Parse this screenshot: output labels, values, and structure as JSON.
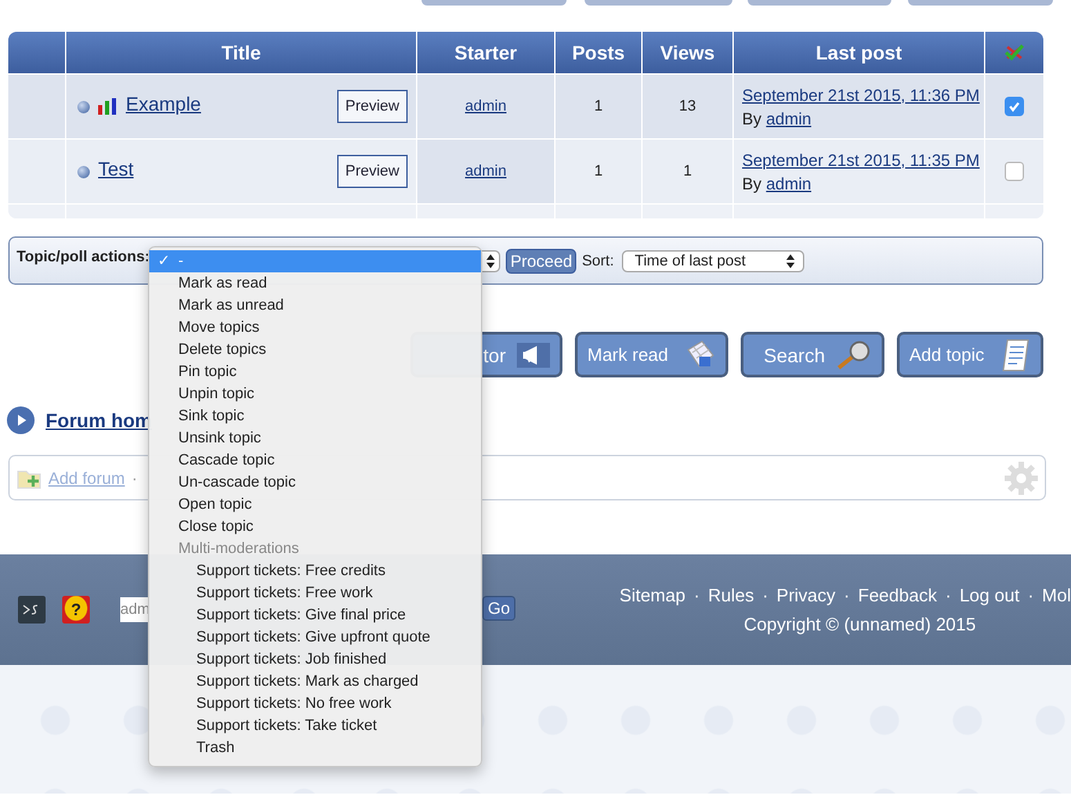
{
  "table": {
    "columns": [
      "Title",
      "Starter",
      "Posts",
      "Views",
      "Last post"
    ],
    "rows": [
      {
        "kind": "poll",
        "title": "Example",
        "preview": "Preview",
        "starter": "admin",
        "posts": "1",
        "views": "13",
        "last_post": "September 21st 2015, 11:36 PM",
        "by": "By",
        "last_author": "admin",
        "checked": true
      },
      {
        "kind": "topic",
        "title": "Test",
        "preview": "Preview",
        "starter": "admin",
        "posts": "1",
        "views": "1",
        "last_post": "September 21st 2015, 11:35 PM",
        "by": "By",
        "last_author": "admin",
        "checked": false
      }
    ]
  },
  "actions": {
    "label": "Topic/poll actions:",
    "proceed": "Proceed",
    "sort_label": "Sort:",
    "sort_value": "Time of last post"
  },
  "menu": {
    "check_mark": "✓",
    "items": [
      {
        "kind": "option",
        "label": "-",
        "selected": true
      },
      {
        "kind": "option",
        "label": "Mark as read",
        "selected": false
      },
      {
        "kind": "option",
        "label": "Mark as unread",
        "selected": false
      },
      {
        "kind": "option",
        "label": "Move topics",
        "selected": false
      },
      {
        "kind": "option",
        "label": "Delete topics",
        "selected": false
      },
      {
        "kind": "option",
        "label": "Pin topic",
        "selected": false
      },
      {
        "kind": "option",
        "label": "Unpin topic",
        "selected": false
      },
      {
        "kind": "option",
        "label": "Sink topic",
        "selected": false
      },
      {
        "kind": "option",
        "label": "Unsink topic",
        "selected": false
      },
      {
        "kind": "option",
        "label": "Cascade topic",
        "selected": false
      },
      {
        "kind": "option",
        "label": "Un-cascade topic",
        "selected": false
      },
      {
        "kind": "option",
        "label": "Open topic",
        "selected": false
      },
      {
        "kind": "option",
        "label": "Close topic",
        "selected": false
      },
      {
        "kind": "group",
        "label": "Multi-moderations",
        "children": [
          {
            "kind": "option",
            "label": "Support tickets: Free credits",
            "selected": false
          },
          {
            "kind": "option",
            "label": "Support tickets: Free work",
            "selected": false
          },
          {
            "kind": "option",
            "label": "Support tickets: Give final price",
            "selected": false
          },
          {
            "kind": "option",
            "label": "Support tickets: Give upfront quote",
            "selected": false
          },
          {
            "kind": "option",
            "label": "Support tickets: Job finished",
            "selected": false
          },
          {
            "kind": "option",
            "label": "Support tickets: Mark as charged",
            "selected": false
          },
          {
            "kind": "option",
            "label": "Support tickets: No free work",
            "selected": false
          },
          {
            "kind": "option",
            "label": "Support tickets: Take ticket",
            "selected": false
          },
          {
            "kind": "option",
            "label": "Trash",
            "selected": false
          }
        ]
      }
    ]
  },
  "buttons": [
    {
      "kind": "megaphone",
      "label": "tor"
    },
    {
      "kind": "mark",
      "label": "Mark read"
    },
    {
      "kind": "search",
      "label": "Search"
    },
    {
      "kind": "add",
      "label": "Add topic"
    }
  ],
  "breadcrumb": {
    "label": "Forum hom"
  },
  "admin_bar": {
    "add_forum": "Add forum",
    "separator": "·"
  },
  "footer": {
    "help_glyph": "?",
    "search_value": "adm",
    "go": "Go",
    "links": [
      "Sitemap",
      "Rules",
      "Privacy",
      "Feedback",
      "Log out",
      "Mol"
    ],
    "separator": "·",
    "copyright": "Copyright © (unnamed) 2015"
  }
}
